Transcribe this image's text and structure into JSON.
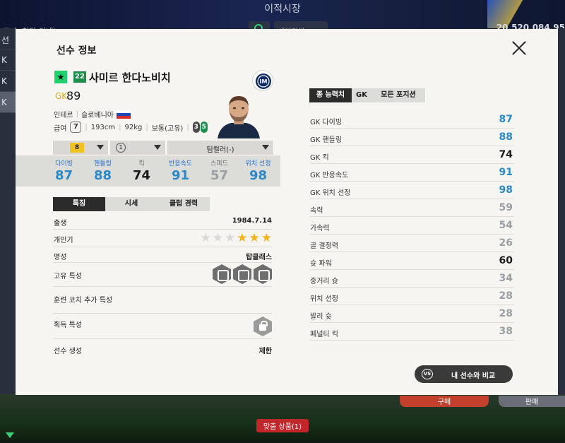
{
  "background": {
    "title": "이적시장",
    "search_text": "드머, 현타 안내)",
    "filter_text": "세분검색",
    "money": "20,520,084,95",
    "left_rows": [
      "선",
      "K",
      "K",
      "K"
    ],
    "buy_label": "구매",
    "sell_label": "판매",
    "recommend_label": "맞춤 상품(1)"
  },
  "modal": {
    "title": "선수 정보",
    "close_icon": "close-icon"
  },
  "player": {
    "season": "22",
    "name": "사미르 한다노비치",
    "position": "GK",
    "ovr": "89",
    "club": "인테르",
    "nation": "슬로베니아",
    "wage_label": "급여",
    "wage": "7",
    "height": "193cm",
    "weight": "92kg",
    "body_type": "보통(고유)",
    "foot_left": "3",
    "foot_right": "5"
  },
  "dropdowns": {
    "grade": "8",
    "level": "①",
    "team_color": "팀컬러(-)"
  },
  "key_stats": [
    {
      "label": "다이빙",
      "value": "87"
    },
    {
      "label": "핸들링",
      "value": "88"
    },
    {
      "label": "킥",
      "value": "74"
    },
    {
      "label": "반응속도",
      "value": "91"
    },
    {
      "label": "스피드",
      "value": "57"
    },
    {
      "label": "위치 선정",
      "value": "98"
    }
  ],
  "subtabs": [
    "특징",
    "시세",
    "클럽 경력"
  ],
  "info": {
    "birth_label": "출생",
    "birth": "1984.7.14",
    "popularity_label": "개인기",
    "popularity_stars": 3,
    "popularity_max": 6,
    "fame_label": "명성",
    "fame": "탑클래스",
    "traits_label": "고유 특성",
    "coach_label": "훈련 코치 추가 특성",
    "acquired_label": "획득 특성",
    "generation_label": "선수 생성",
    "generation": "제한"
  },
  "right_tabs": [
    "종 능력치",
    "GK",
    "모든 포지션"
  ],
  "stats": [
    {
      "name": "GK 다이빙",
      "value": "87",
      "color": "#2a89c8"
    },
    {
      "name": "GK 핸들링",
      "value": "88",
      "color": "#2a89c8"
    },
    {
      "name": "GK 킥",
      "value": "74",
      "color": "#1a1a1a"
    },
    {
      "name": "GK 반응속도",
      "value": "91",
      "color": "#2a89c8"
    },
    {
      "name": "GK 위치 선정",
      "value": "98",
      "color": "#2a89c8"
    },
    {
      "name": "속력",
      "value": "59",
      "color": "#9aa0a6"
    },
    {
      "name": "가속력",
      "value": "54",
      "color": "#9aa0a6"
    },
    {
      "name": "골 결정력",
      "value": "26",
      "color": "#9aa0a6"
    },
    {
      "name": "슛 파워",
      "value": "60",
      "color": "#1a1a1a"
    },
    {
      "name": "중거리 슛",
      "value": "34",
      "color": "#9aa0a6"
    },
    {
      "name": "위치 선정",
      "value": "28",
      "color": "#9aa0a6"
    },
    {
      "name": "발리 슛",
      "value": "28",
      "color": "#9aa0a6"
    },
    {
      "name": "페널티 킥",
      "value": "38",
      "color": "#9aa0a6"
    }
  ],
  "compare_button": "내 선수와 비교",
  "compare_icon_text": "VS"
}
